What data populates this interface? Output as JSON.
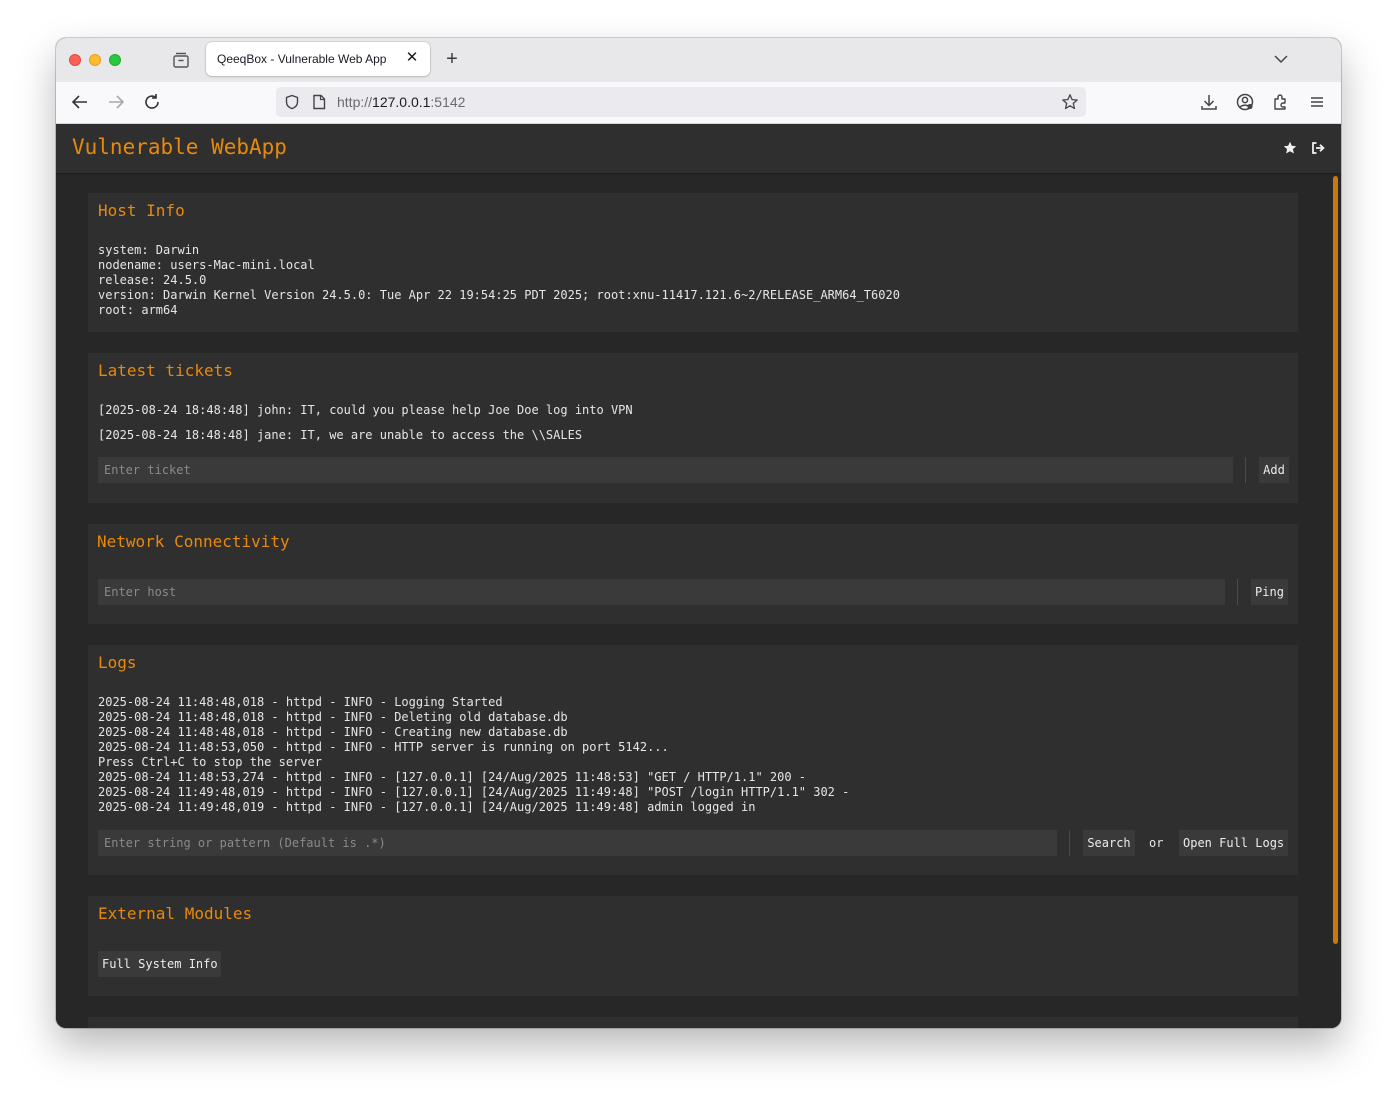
{
  "browser": {
    "tab_title": "QeeqBox - Vulnerable Web App",
    "tab_close": "✕",
    "new_tab": "+",
    "url_scheme": "http://",
    "url_host": "127.0.0.1",
    "url_port": ":5142"
  },
  "app": {
    "title": "Vulnerable WebApp"
  },
  "host_info": {
    "title": "Host Info",
    "lines": "system: Darwin\nnodename: users-Mac-mini.local\nrelease: 24.5.0\nversion: Darwin Kernel Version 24.5.0: Tue Apr 22 19:54:25 PDT 2025; root:xnu-11417.121.6~2/RELEASE_ARM64_T6020\nroot: arm64"
  },
  "tickets": {
    "title": "Latest tickets",
    "items": [
      "[2025-08-24 18:48:48] john: IT, could you please help Joe Doe log into VPN",
      "[2025-08-24 18:48:48] jane: IT, we are unable to access the \\\\SALES"
    ],
    "input_placeholder": "Enter ticket",
    "add_label": "Add"
  },
  "network": {
    "title": "Network Connectivity",
    "input_placeholder": "Enter host",
    "ping_label": "Ping"
  },
  "logs": {
    "title": "Logs",
    "lines": "2025-08-24 11:48:48,018 - httpd - INFO - Logging Started\n2025-08-24 11:48:48,018 - httpd - INFO - Deleting old database.db\n2025-08-24 11:48:48,018 - httpd - INFO - Creating new database.db\n2025-08-24 11:48:53,050 - httpd - INFO - HTTP server is running on port 5142...\nPress Ctrl+C to stop the server\n2025-08-24 11:48:53,274 - httpd - INFO - [127.0.0.1] [24/Aug/2025 11:48:53] \"GET / HTTP/1.1\" 200 -\n2025-08-24 11:49:48,019 - httpd - INFO - [127.0.0.1] [24/Aug/2025 11:49:48] \"POST /login HTTP/1.1\" 302 -\n2025-08-24 11:49:48,019 - httpd - INFO - [127.0.0.1] [24/Aug/2025 11:49:48] admin logged in",
    "search_placeholder": "Enter string or pattern (Default is .*)",
    "search_label": "Search",
    "or_label": "or",
    "full_logs_label": "Open Full Logs"
  },
  "external_modules": {
    "title": "External Modules",
    "full_system_info_label": "Full System Info"
  },
  "colors": {
    "accent": "#e8890c",
    "content_bg": "#272727",
    "card_bg": "#2f2f2f"
  }
}
